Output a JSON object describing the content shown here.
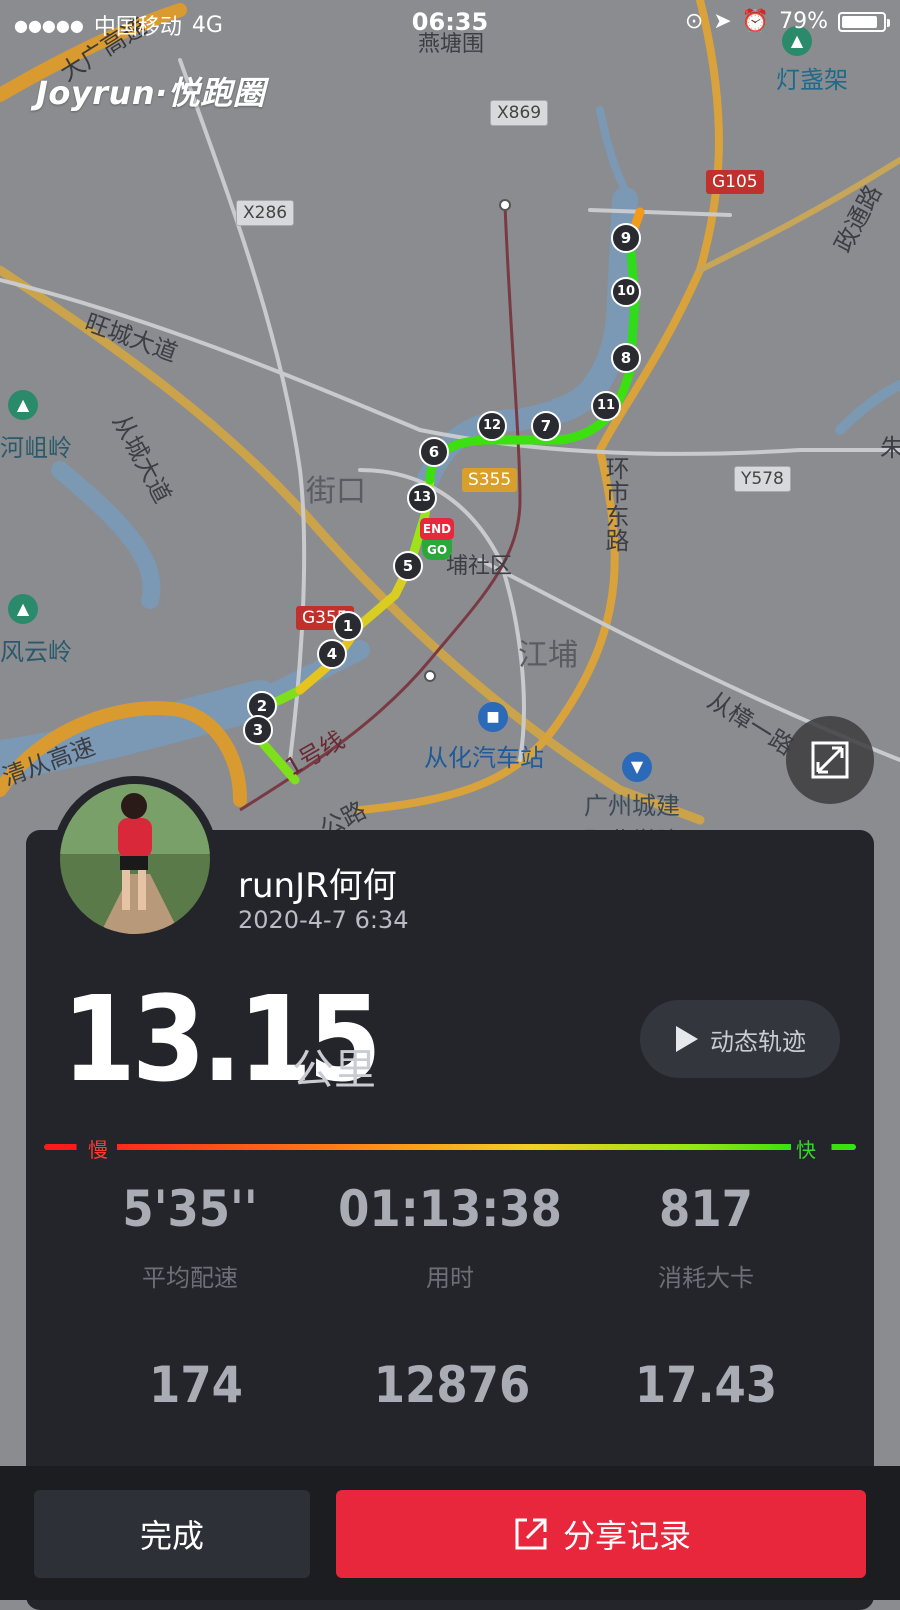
{
  "status_bar": {
    "signal": "●●●●●",
    "carrier": "中国移动",
    "network": "4G",
    "time": "06:35",
    "battery": "79%"
  },
  "brand": "Joyrun·悦跑圈",
  "map": {
    "labels": {
      "yantang": "燕塘围",
      "dengzhanjia": "灯盏架",
      "wangcheng": "旺城大道",
      "congcheng": "从城大道",
      "jiekou": "街口",
      "jiangpu": "江埔",
      "huanshi": "环市东路",
      "zhengtong": "政通路",
      "shequ": "埔社区",
      "bus_station": "从化汽车站",
      "college_line1": "广州城建",
      "college_line2": "职业学院",
      "peak1": "河岨岭",
      "peak2": "风云岭",
      "qingcong": "清从高速",
      "congzhang": "从樟一路",
      "line1": "1号线",
      "gonglu": "公路",
      "dachang": "大广高速",
      "zhu": "朱"
    },
    "badges": {
      "x869": "X869",
      "x286": "X286",
      "g105": "G105",
      "s355": "S355",
      "g355": "G355",
      "y578": "Y578"
    },
    "km_markers": [
      "1",
      "2",
      "3",
      "4",
      "5",
      "6",
      "7",
      "8",
      "9",
      "10",
      "11",
      "12",
      "13"
    ],
    "end_label": "END",
    "go_label": "GO"
  },
  "profile": {
    "username": "runJR何何",
    "date": "2020-4-7 6:34"
  },
  "run": {
    "distance": "13.15",
    "unit": "公里",
    "replay_label": "动态轨迹"
  },
  "pace_scale": {
    "slow": "慢",
    "fast": "快"
  },
  "stats": [
    {
      "value": "5'35''",
      "label": "平均配速"
    },
    {
      "value": "01:13:38",
      "label": "用时"
    },
    {
      "value": "817",
      "label": "消耗大卡"
    },
    {
      "value": "174",
      "label": ""
    },
    {
      "value": "12876",
      "label": ""
    },
    {
      "value": "17.43",
      "label": ""
    }
  ],
  "actions": {
    "done": "完成",
    "share": "分享记录"
  },
  "colors": {
    "accent": "#e8273d",
    "card": "#24252a",
    "route_fast": "#3ce00f",
    "route_slow": "#ff7a1a"
  }
}
